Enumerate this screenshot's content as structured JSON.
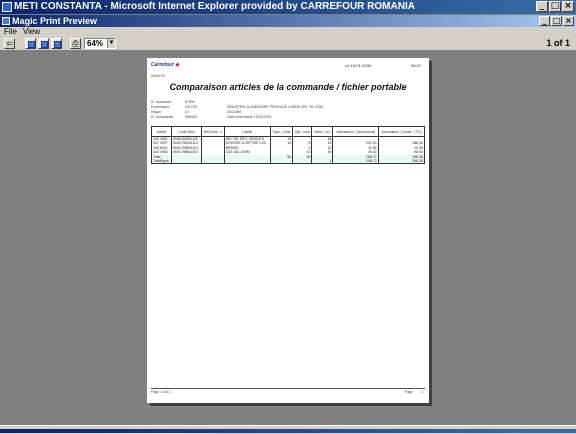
{
  "ie_window": {
    "title": "METI CONSTANTA - Microsoft Internet Explorer provided by CARREFOUR ROMANIA"
  },
  "preview_window": {
    "title": "Magic Print Preview"
  },
  "menu": {
    "items": [
      "File",
      "View"
    ]
  },
  "toolbar": {
    "zoom": "64%",
    "page_count": "1 of 1"
  },
  "paper": {
    "logo": "Carrefour",
    "date": "Le 15-01-2009",
    "time": "09:07",
    "subtitle": "ANNEXE",
    "title": "Comparaison articles de la commande / fichier portable",
    "meta": [
      {
        "k": "N° document",
        "v": "87599",
        "x": ""
      },
      {
        "k": "Fournisseur",
        "v": "131726",
        "x": "INDUSTRIE ALIMENTARE PRODUSE CARNE SRL          Tel: 0258"
      },
      {
        "k": "Rayon",
        "v": "01",
        "x": "LEGUME"
      },
      {
        "k": "N° commande",
        "v": "908405",
        "x": "Date commande          13/01/2009"
      }
    ],
    "table": {
      "headers": [
        "Article",
        "Code EAN",
        "Ref fourn. 1",
        "Libelle",
        "Type / Colis",
        "Qté / cmd",
        "Stock / UC",
        "Valorisation / (cout achat)",
        "Valorisation / (vente, TTC)"
      ],
      "rows": [
        [
          "340 4962",
          "5948430651120",
          "",
          "BEC DE SPIC VERDE 8",
          "10",
          "",
          "66",
          "",
          ""
        ],
        [
          "347 4937",
          "5941798431114",
          "",
          "SHOORE & SETTER 120",
          "10",
          "5",
          "15",
          "212,00",
          "286,40"
        ],
        [
          "348 6041",
          "5941748591114",
          "",
          "BRISKE",
          "",
          "4",
          "12",
          "11,85",
          "13,35"
        ],
        [
          "340 4963",
          "5941798601002",
          "",
          "CAT SALJCRM",
          "",
          "10",
          "40",
          "76,00",
          "98,60"
        ],
        [
          "Total",
          "",
          "",
          "",
          "50",
          "40",
          "",
          "298,72",
          "398,35"
        ],
        [
          "Total/ligne",
          "",
          "",
          "",
          "",
          "",
          "1",
          "298,72",
          "398,35"
        ]
      ]
    },
    "footer": {
      "left": "Page 1 sur 1",
      "right": "Page",
      "num": "1"
    }
  }
}
